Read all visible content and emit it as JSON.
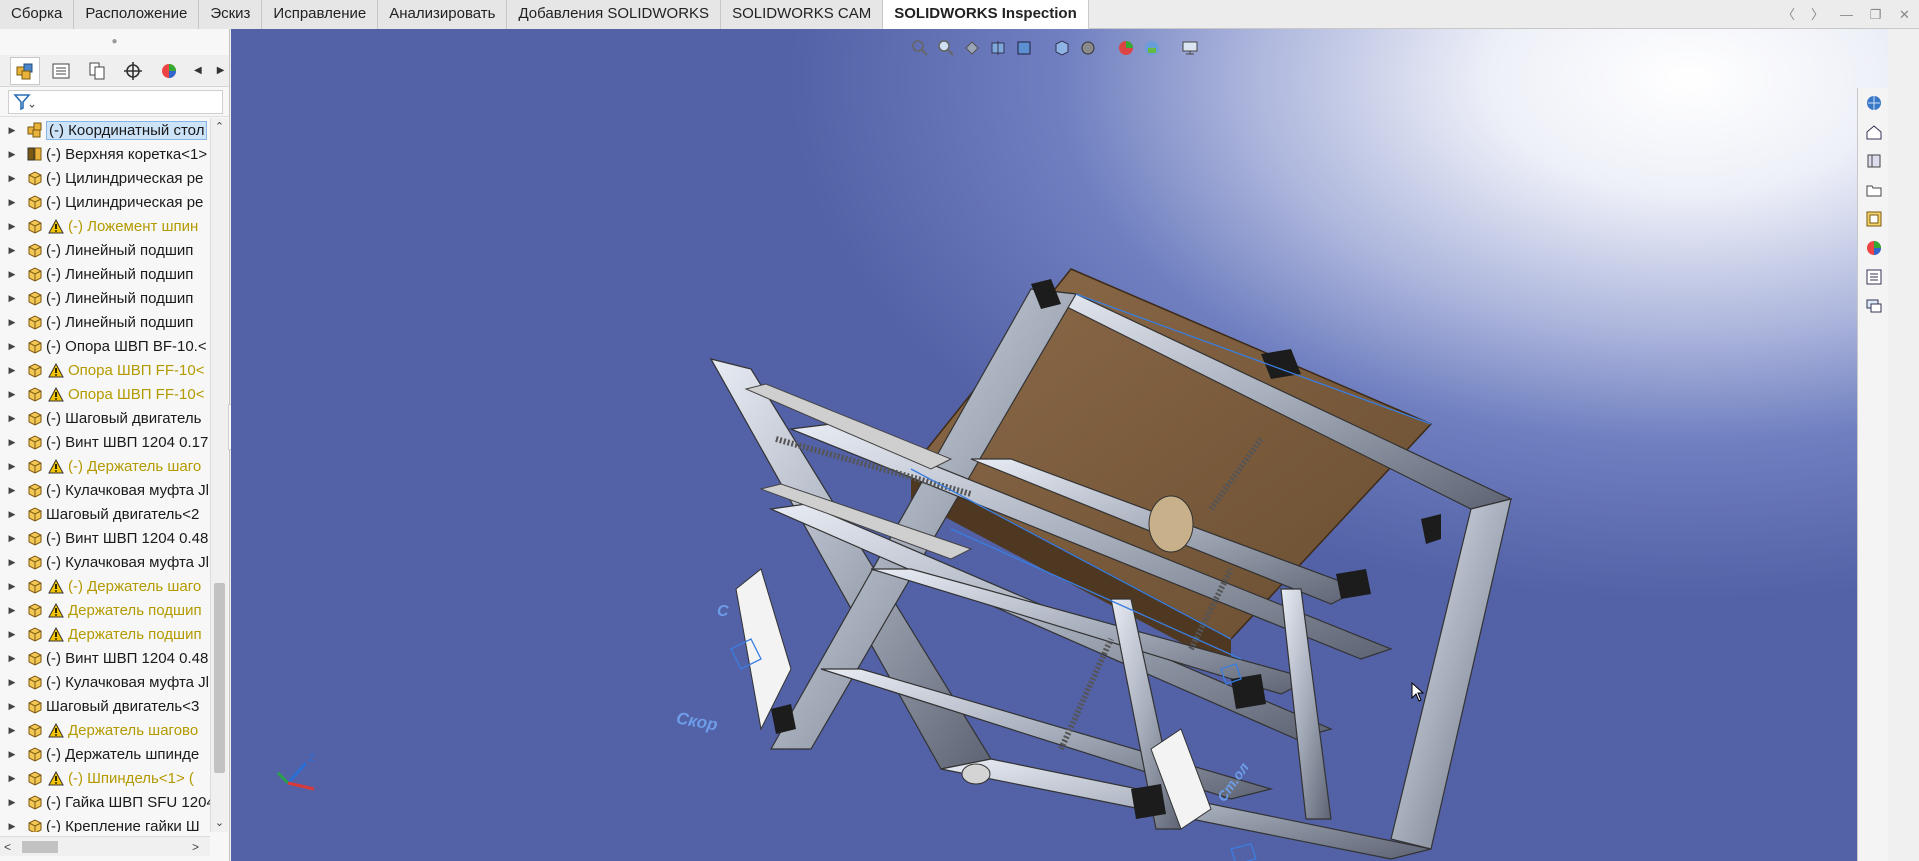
{
  "command_tabs": [
    {
      "label": "Сборка",
      "active": false
    },
    {
      "label": "Расположение",
      "active": false
    },
    {
      "label": "Эскиз",
      "active": false
    },
    {
      "label": "Исправление",
      "active": false
    },
    {
      "label": "Анализировать",
      "active": false
    },
    {
      "label": "Добавления SOLIDWORKS",
      "active": false
    },
    {
      "label": "SOLIDWORKS CAM",
      "active": false
    },
    {
      "label": "SOLIDWORKS Inspection",
      "active": true
    }
  ],
  "tree": [
    {
      "label": "(-) Координатный стол",
      "icon": "assembly-icon",
      "warn": false,
      "selected": true
    },
    {
      "label": "(-) Верхняя коретка<1>",
      "icon": "subassembly-icon",
      "warn": false
    },
    {
      "label": "(-) Цилиндрическая ре",
      "icon": "part-icon",
      "warn": false
    },
    {
      "label": "(-) Цилиндрическая ре",
      "icon": "part-icon",
      "warn": false
    },
    {
      "label": "(-) Ложемент шпин",
      "icon": "part-icon",
      "warn": true
    },
    {
      "label": "(-) Линейный подшип",
      "icon": "part-icon",
      "warn": false
    },
    {
      "label": "(-) Линейный подшип",
      "icon": "part-icon",
      "warn": false
    },
    {
      "label": "(-) Линейный подшип",
      "icon": "part-icon",
      "warn": false
    },
    {
      "label": "(-) Линейный подшип",
      "icon": "part-icon",
      "warn": false
    },
    {
      "label": "(-) Опора ШВП BF-10.<",
      "icon": "part-icon",
      "warn": false
    },
    {
      "label": "Опора ШВП FF-10<",
      "icon": "part-icon",
      "warn": true
    },
    {
      "label": "Опора ШВП FF-10<",
      "icon": "part-icon",
      "warn": true
    },
    {
      "label": "(-) Шаговый двигатель",
      "icon": "part-icon",
      "warn": false
    },
    {
      "label": "(-) Винт ШВП 1204 0.17",
      "icon": "part-icon",
      "warn": false
    },
    {
      "label": "(-) Держатель шаго",
      "icon": "part-icon",
      "warn": true
    },
    {
      "label": "(-) Кулачковая муфта Jl",
      "icon": "part-icon",
      "warn": false
    },
    {
      "label": "Шаговый двигатель<2",
      "icon": "part-icon",
      "warn": false
    },
    {
      "label": "(-) Винт ШВП 1204 0.48",
      "icon": "part-icon",
      "warn": false
    },
    {
      "label": "(-) Кулачковая муфта Jl",
      "icon": "part-icon",
      "warn": false
    },
    {
      "label": "(-) Держатель шаго",
      "icon": "part-icon",
      "warn": true
    },
    {
      "label": "Держатель подшип",
      "icon": "part-icon",
      "warn": true
    },
    {
      "label": "Держатель подшип",
      "icon": "part-icon",
      "warn": true
    },
    {
      "label": "(-) Винт ШВП 1204 0.48",
      "icon": "part-icon",
      "warn": false
    },
    {
      "label": "(-) Кулачковая муфта Jl",
      "icon": "part-icon",
      "warn": false
    },
    {
      "label": "Шаговый двигатель<3",
      "icon": "part-icon",
      "warn": false
    },
    {
      "label": "Держатель шагово",
      "icon": "part-icon",
      "warn": true
    },
    {
      "label": "(-) Держатель шпинде",
      "icon": "part-icon",
      "warn": false
    },
    {
      "label": "(-) Шпиндель<1> (",
      "icon": "part-icon",
      "warn": true
    },
    {
      "label": "(-) Гайка ШВП SFU 1204",
      "icon": "part-icon",
      "warn": false
    },
    {
      "label": "(-) Крепление гайки Ш",
      "icon": "part-icon",
      "warn": false
    }
  ],
  "viewport_labels": {
    "sketch_c": "C",
    "sketch_ckop": "Скор",
    "sketch_right": "Ст.ол"
  },
  "colors": {
    "accent": "#88b6e4",
    "warning_text": "#b39a00",
    "bg_dark": "#5361a6"
  }
}
